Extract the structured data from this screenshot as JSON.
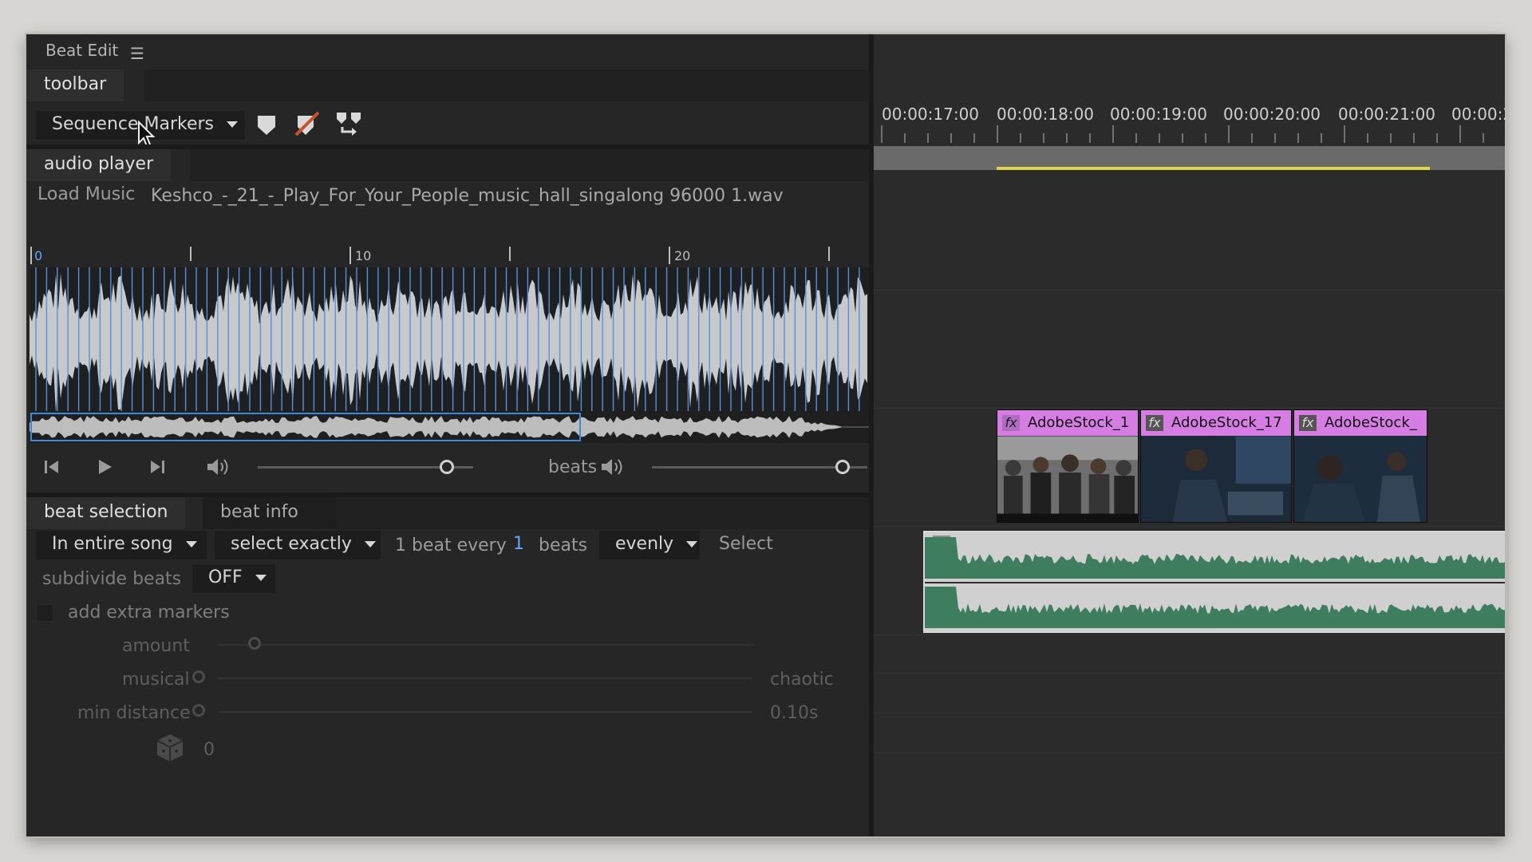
{
  "panel": {
    "title": "Beat Edit",
    "menu_icon": "hamburger-icon"
  },
  "toolbar": {
    "section_label": "toolbar",
    "marker_mode": "Sequence Markers",
    "icons": [
      "marker-icon",
      "clear-markers-icon",
      "merge-markers-icon"
    ]
  },
  "audio_player": {
    "section_label": "audio player",
    "load_label": "Load Music",
    "file_name": "Keshco_-_21_-_Play_For_Your_People_music_hall_singalong 96000 1.wav",
    "ruler_labels": [
      "0",
      "10",
      "20"
    ],
    "beats_label": "beats",
    "accent_color": "#3d8bd8"
  },
  "beat_panel": {
    "tabs": [
      "beat selection",
      "beat info"
    ],
    "scope": "In entire song",
    "selection_mode": "select exactly",
    "beat_every_prefix": "1 beat every",
    "beat_every_value": "1",
    "beat_every_suffix": "beats",
    "distribution": "evenly",
    "select_button": "Select",
    "subdivide_label": "subdivide beats",
    "subdivide_value": "OFF",
    "add_extra_label": "add extra markers",
    "amount_label": "amount",
    "musical_label": "musical",
    "chaotic_label": "chaotic",
    "min_distance_label": "min distance",
    "min_distance_value": "0.10s",
    "seed_value": "0"
  },
  "timeline": {
    "timecodes": [
      "00:00:17:00",
      "00:00:18:00",
      "00:00:19:00",
      "00:00:20:00",
      "00:00:21:00",
      "00:00:2"
    ],
    "clips": [
      "AdobeStock_1",
      "AdobeStock_17",
      "AdobeStock_"
    ],
    "clip_color": "#d57de3",
    "audio_color": "#3f7d5f",
    "inout_color": "#e1d347"
  }
}
